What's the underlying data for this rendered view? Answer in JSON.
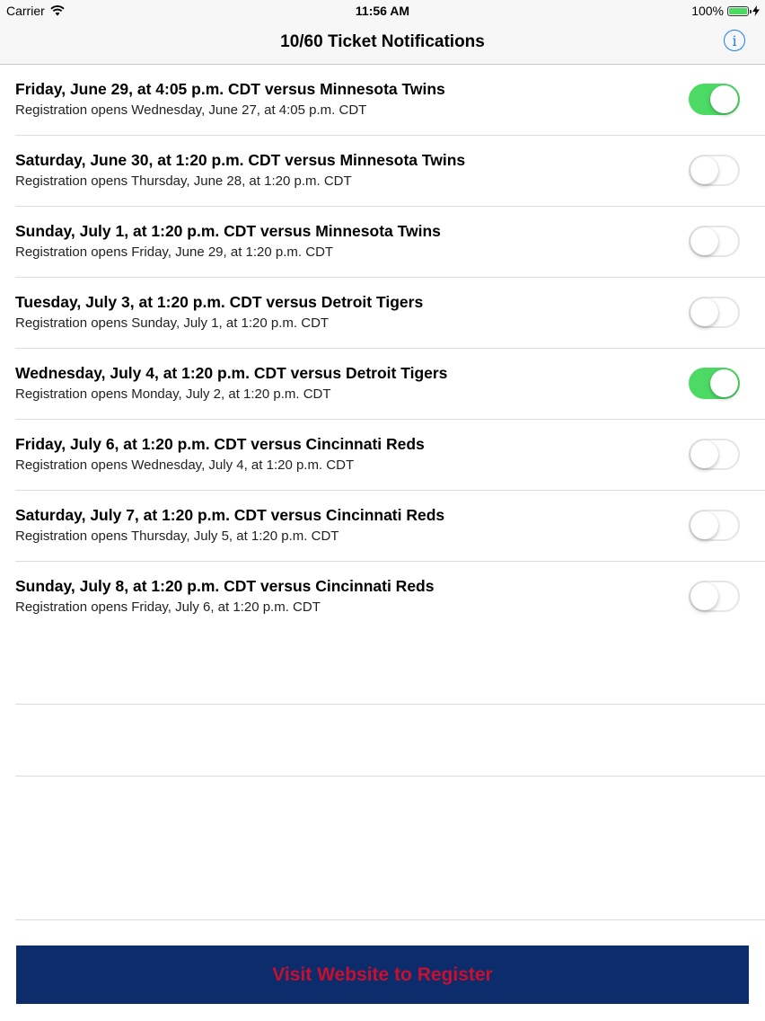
{
  "status_bar": {
    "carrier": "Carrier",
    "time": "11:56 AM",
    "battery": "100%",
    "battery_level": 1.0
  },
  "navbar": {
    "title": "10/60 Ticket Notifications",
    "info_icon": "info-icon",
    "info_glyph": "i",
    "accent_color": "#1a7ef5"
  },
  "games": [
    {
      "title": "Friday, June 29, at 4:05 p.m. CDT versus Minnesota Twins",
      "subtitle": "Registration opens Wednesday, June 27, at 4:05 p.m. CDT",
      "enabled": true
    },
    {
      "title": "Saturday, June 30, at 1:20 p.m. CDT versus Minnesota Twins",
      "subtitle": "Registration opens Thursday, June 28, at 1:20 p.m. CDT",
      "enabled": false
    },
    {
      "title": "Sunday, July 1, at 1:20 p.m. CDT versus Minnesota Twins",
      "subtitle": "Registration opens Friday, June 29, at 1:20 p.m. CDT",
      "enabled": false
    },
    {
      "title": "Tuesday, July 3, at 1:20 p.m. CDT versus Detroit Tigers",
      "subtitle": "Registration opens Sunday, July 1, at 1:20 p.m. CDT",
      "enabled": false
    },
    {
      "title": "Wednesday, July 4, at 1:20 p.m. CDT versus Detroit Tigers",
      "subtitle": "Registration opens Monday, July 2, at 1:20 p.m. CDT",
      "enabled": true
    },
    {
      "title": "Friday, July 6, at 1:20 p.m. CDT versus Cincinnati Reds",
      "subtitle": "Registration opens Wednesday, July 4, at 1:20 p.m. CDT",
      "enabled": false
    },
    {
      "title": "Saturday, July 7, at 1:20 p.m. CDT versus Cincinnati Reds",
      "subtitle": "Registration opens Thursday, July 5, at 1:20 p.m. CDT",
      "enabled": false
    },
    {
      "title": "Sunday, July 8, at 1:20 p.m. CDT versus Cincinnati Reds",
      "subtitle": "Registration opens Friday, July 6, at 1:20 p.m. CDT",
      "enabled": false
    }
  ],
  "colors": {
    "toggle_on": "#4cd964",
    "register_bg": "#0c2c6b",
    "register_text": "#c8102e"
  },
  "register_button": {
    "label": "Visit Website to Register"
  }
}
